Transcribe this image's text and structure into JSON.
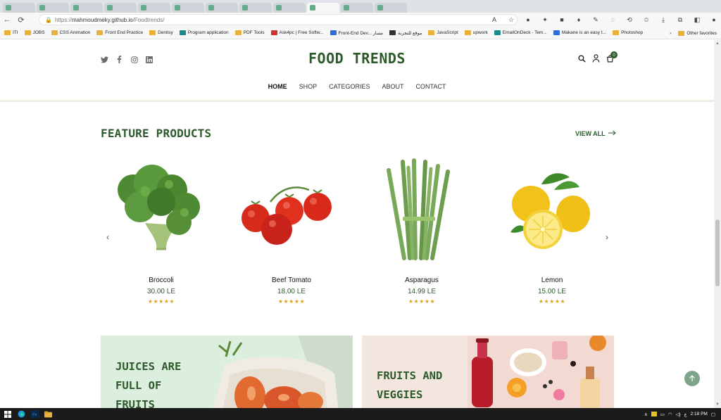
{
  "browser": {
    "url_prefix": "https://",
    "url_host": "mahmoudmeky.github.io",
    "url_path": "/Foodtrends/",
    "bookmarks": [
      "ITI",
      "JOBS",
      "CSS Animation",
      "Front End Practice",
      "Dentisy",
      "Program application",
      "PDF Tools",
      "Ask4pc | Free Softw...",
      "Front-End Dev... مسار",
      "موقع للتجربة",
      "JavaScript",
      "upwork",
      "EmailOnDeck - Tem...",
      "Makane is an easy t...",
      "Photoshop"
    ],
    "other_favorites": "Other favorites"
  },
  "header": {
    "logo": "FOOD TRENDS",
    "cart_count": "0",
    "menu": [
      {
        "label": "HOME",
        "active": true
      },
      {
        "label": "SHOP"
      },
      {
        "label": "CATEGORIES"
      },
      {
        "label": "ABOUT"
      },
      {
        "label": "CONTACT"
      }
    ]
  },
  "featured": {
    "title": "FEATURE PRODUCTS",
    "view_all": "VIEW ALL",
    "products": [
      {
        "name": "Broccoli",
        "price": "30.00 LE",
        "rating": 5
      },
      {
        "name": "Beef Tomato",
        "price": "18.00 LE",
        "rating": 5
      },
      {
        "name": "Asparagus",
        "price": "14.99 LE",
        "rating": 5
      },
      {
        "name": "Lemon",
        "price": "15.00 LE",
        "rating": 5
      }
    ]
  },
  "banners": {
    "left_lines": [
      "JUICES ARE",
      "FULL OF",
      "FRUITS"
    ],
    "right_lines": [
      "FRUITS AND",
      "VEGGIES"
    ]
  },
  "taskbar": {
    "time": "2:18 PM"
  },
  "colors": {
    "brand_green": "#2c5a2a",
    "star": "#d8a21e"
  }
}
